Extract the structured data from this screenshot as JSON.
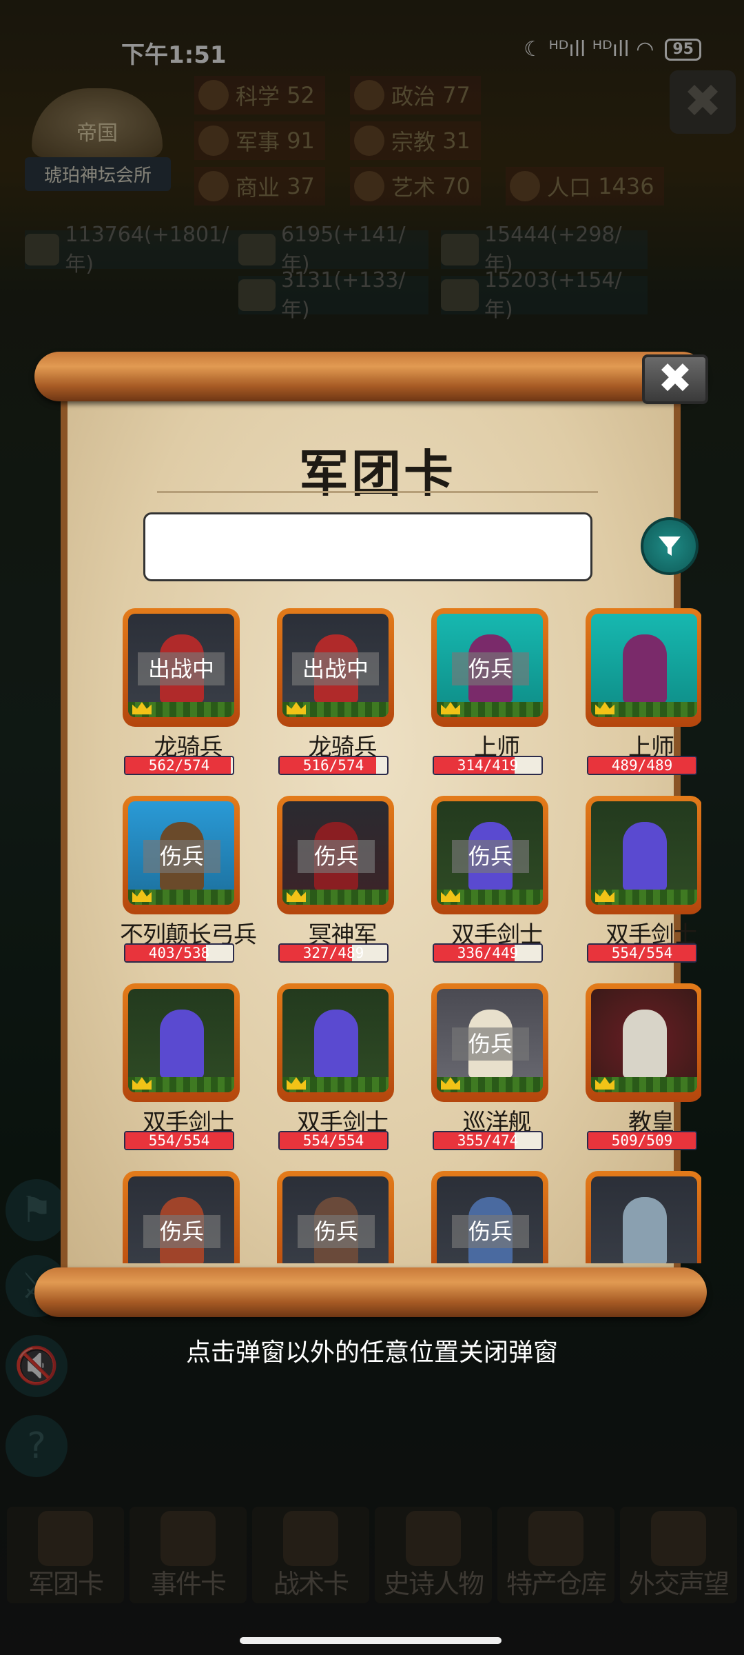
{
  "status_bar": {
    "time": "下午1:51",
    "signal_icons": "☾ ᴴᴰıll ᴴᴰıll ◠",
    "battery": "95"
  },
  "empire": {
    "emblem_text": "帝国",
    "name": "琥珀神坛会所"
  },
  "stats": [
    {
      "label": "科学",
      "value": "52"
    },
    {
      "label": "政治",
      "value": "77"
    },
    {
      "label": "军事",
      "value": "91"
    },
    {
      "label": "宗教",
      "value": "31"
    },
    {
      "label": "商业",
      "value": "37"
    },
    {
      "label": "艺术",
      "value": "70"
    },
    {
      "label": "人口",
      "value": "1436"
    }
  ],
  "resources": [
    "113764(+1801/年)",
    "6195(+141/年)",
    "15444(+298/年)",
    "3131(+133/年)",
    "15203(+154/年)"
  ],
  "background_close": "✖",
  "side_buttons": [
    "⚑",
    "⚔",
    "🔇",
    "?"
  ],
  "bottom_nav": [
    "军团卡",
    "事件卡",
    "战术卡",
    "史诗人物",
    "特产仓库",
    "外交声望"
  ],
  "modal": {
    "title": "军团卡",
    "close": "✖",
    "search_value": "",
    "search_placeholder": "",
    "filter_icon": "filter-icon"
  },
  "cards": [
    {
      "name": "龙骑兵",
      "tag": "出战中",
      "hp": "562/574",
      "hp_fraction": 0.98
    },
    {
      "name": "龙骑兵",
      "tag": "出战中",
      "hp": "516/574",
      "hp_fraction": 0.9
    },
    {
      "name": "上师",
      "tag": "伤兵",
      "hp": "314/419",
      "hp_fraction": 0.75
    },
    {
      "name": "上师",
      "tag": "",
      "hp": "489/489",
      "hp_fraction": 1.0
    },
    {
      "name": "不列颠长弓兵",
      "tag": "伤兵",
      "hp": "403/538",
      "hp_fraction": 0.75
    },
    {
      "name": "冥神军",
      "tag": "伤兵",
      "hp": "327/489",
      "hp_fraction": 0.67
    },
    {
      "name": "双手剑士",
      "tag": "伤兵",
      "hp": "336/449",
      "hp_fraction": 0.75
    },
    {
      "name": "双手剑士",
      "tag": "",
      "hp": "554/554",
      "hp_fraction": 1.0
    },
    {
      "name": "双手剑士",
      "tag": "",
      "hp": "554/554",
      "hp_fraction": 1.0
    },
    {
      "name": "双手剑士",
      "tag": "",
      "hp": "554/554",
      "hp_fraction": 1.0
    },
    {
      "name": "巡洋舰",
      "tag": "伤兵",
      "hp": "355/474",
      "hp_fraction": 0.75
    },
    {
      "name": "教皇",
      "tag": "",
      "hp": "509/509",
      "hp_fraction": 1.0
    },
    {
      "name": "",
      "tag": "伤兵",
      "hp": "",
      "hp_fraction": 0
    },
    {
      "name": "",
      "tag": "伤兵",
      "hp": "",
      "hp_fraction": 0
    },
    {
      "name": "",
      "tag": "伤兵",
      "hp": "",
      "hp_fraction": 0
    },
    {
      "name": "",
      "tag": "",
      "hp": "",
      "hp_fraction": 0
    }
  ],
  "hint": "点击弹窗以外的任意位置关闭弹窗",
  "colors": {
    "hp_fill": "#e8343c",
    "frame": "#e37b1a",
    "filter_button": "#1f8b86",
    "scroll_rod": "#c97a3a"
  }
}
